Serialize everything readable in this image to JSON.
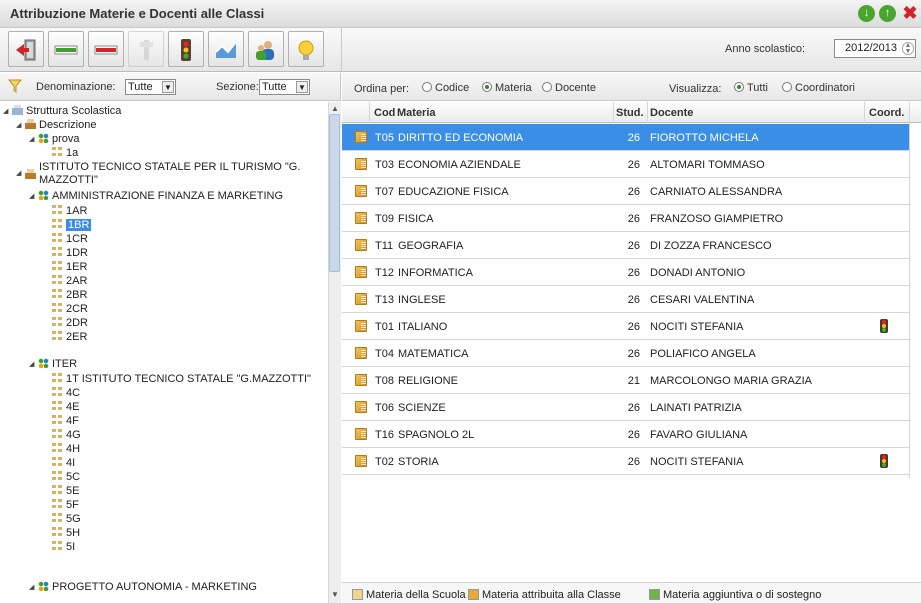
{
  "window": {
    "title": "Attribuzione Materie e Docenti alle Classi"
  },
  "toolbar": {
    "year_label": "Anno scolastico:",
    "year_value": "2012/2013"
  },
  "filters": {
    "denominazione_label": "Denominazione:",
    "denominazione_value": "Tutte",
    "sezione_label": "Sezione:",
    "sezione_value": "Tutte"
  },
  "tree": {
    "root": "Struttura Scolastica",
    "descrizione": "Descrizione",
    "prova": "prova",
    "prova_1a": "1a",
    "istituto_line1": "ISTITUTO TECNICO STATALE PER IL TURISMO \"G.",
    "istituto_line2": "MAZZOTTI\"",
    "afm": "AMMINISTRAZIONE FINANZA E MARKETING",
    "afm_classes": [
      "1AR",
      "1BR",
      "1CR",
      "1DR",
      "1ER",
      "2AR",
      "2BR",
      "2CR",
      "2DR",
      "2ER"
    ],
    "iter": "ITER",
    "iter_classes": [
      "1T ISTITUTO TECNICO STATALE \"G.MAZZOTTI\"",
      "4C",
      "4E",
      "4F",
      "4G",
      "4H",
      "4I",
      "5C",
      "5E",
      "5F",
      "5G",
      "5H",
      "5I"
    ],
    "progetto": "PROGETTO AUTONOMIA - MARKETING",
    "selected": "1BR"
  },
  "grid_filters": {
    "ordina_label": "Ordina per:",
    "ordina_options": [
      "Codice",
      "Materia",
      "Docente"
    ],
    "ordina_selected": "Materia",
    "visualizza_label": "Visualizza:",
    "visualizza_options": [
      "Tutti",
      "Coordinatori"
    ],
    "visualizza_selected": "Tutti"
  },
  "grid": {
    "headers": {
      "cod": "Cod",
      "materia": "Materia",
      "stud": "Stud.",
      "docente": "Docente",
      "coord": "Coord."
    },
    "rows": [
      {
        "cod": "T05",
        "materia": "DIRITTO ED ECONOMIA",
        "stud": "26",
        "docente": "FIOROTTO MICHELA",
        "coord": false,
        "selected": true
      },
      {
        "cod": "T03",
        "materia": "ECONOMIA AZIENDALE",
        "stud": "26",
        "docente": "ALTOMARI TOMMASO",
        "coord": false
      },
      {
        "cod": "T07",
        "materia": "EDUCAZIONE FISICA",
        "stud": "26",
        "docente": "CARNIATO ALESSANDRA",
        "coord": false
      },
      {
        "cod": "T09",
        "materia": "FISICA",
        "stud": "26",
        "docente": "FRANZOSO GIAMPIETRO",
        "coord": false
      },
      {
        "cod": "T11",
        "materia": "GEOGRAFIA",
        "stud": "26",
        "docente": "DI ZOZZA FRANCESCO",
        "coord": false
      },
      {
        "cod": "T12",
        "materia": "INFORMATICA",
        "stud": "26",
        "docente": "DONADI ANTONIO",
        "coord": false
      },
      {
        "cod": "T13",
        "materia": "INGLESE",
        "stud": "26",
        "docente": "CESARI VALENTINA",
        "coord": false
      },
      {
        "cod": "T01",
        "materia": "ITALIANO",
        "stud": "26",
        "docente": "NOCITI STEFANIA",
        "coord": true
      },
      {
        "cod": "T04",
        "materia": "MATEMATICA",
        "stud": "26",
        "docente": "POLIAFICO ANGELA",
        "coord": false
      },
      {
        "cod": "T08",
        "materia": "RELIGIONE",
        "stud": "21",
        "docente": "MARCOLONGO MARIA GRAZIA",
        "coord": false
      },
      {
        "cod": "T06",
        "materia": "SCIENZE",
        "stud": "26",
        "docente": "LAINATI PATRIZIA",
        "coord": false
      },
      {
        "cod": "T16",
        "materia": "SPAGNOLO 2L",
        "stud": "26",
        "docente": "FAVARO GIULIANA",
        "coord": false
      },
      {
        "cod": "T02",
        "materia": "STORIA",
        "stud": "26",
        "docente": "NOCITI STEFANIA",
        "coord": true
      }
    ]
  },
  "legend": {
    "scuola": "Materia della Scuola",
    "classe": "Materia attribuita alla Classe",
    "aggiuntiva": "Materia aggiuntiva o di sostegno"
  },
  "colors": {
    "selection": "#3a8ee6",
    "accent_green": "#4aa52e",
    "close_red": "#d2232a"
  }
}
